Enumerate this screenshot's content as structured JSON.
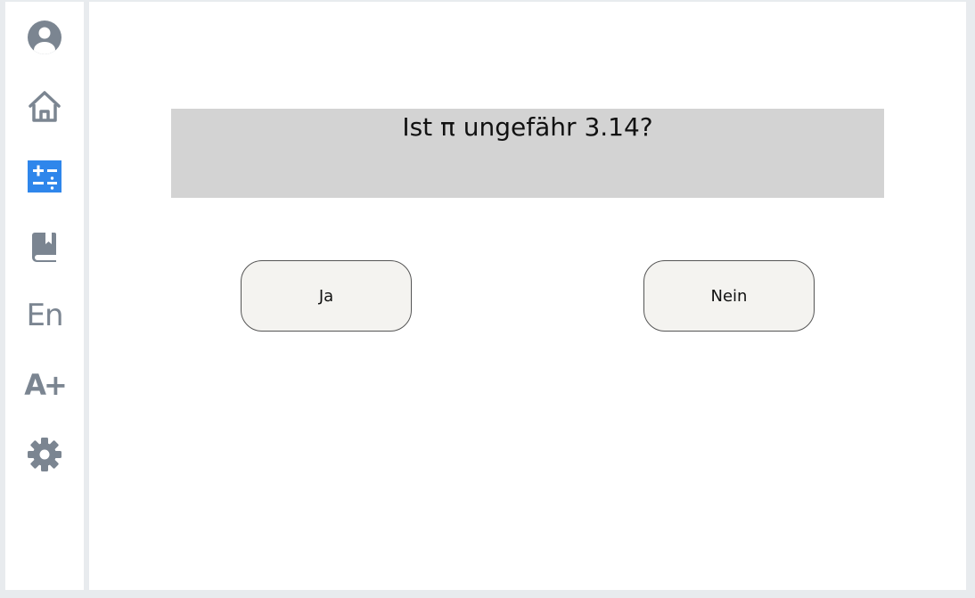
{
  "sidebar": {
    "icon_color": "#7b8591",
    "active_color": "#2f86eb",
    "items": [
      {
        "icon": "user-avatar-icon"
      },
      {
        "icon": "home-icon"
      },
      {
        "icon": "math-operations-icon",
        "active": true
      },
      {
        "icon": "book-icon"
      },
      {
        "icon": "english-language-icon",
        "label": "En"
      },
      {
        "icon": "font-size-increase-icon",
        "label": "A+"
      },
      {
        "icon": "gear-icon"
      }
    ]
  },
  "question": {
    "text": "Ist π ungefähr 3.14?"
  },
  "answers": {
    "yes_label": "Ja",
    "no_label": "Nein"
  }
}
